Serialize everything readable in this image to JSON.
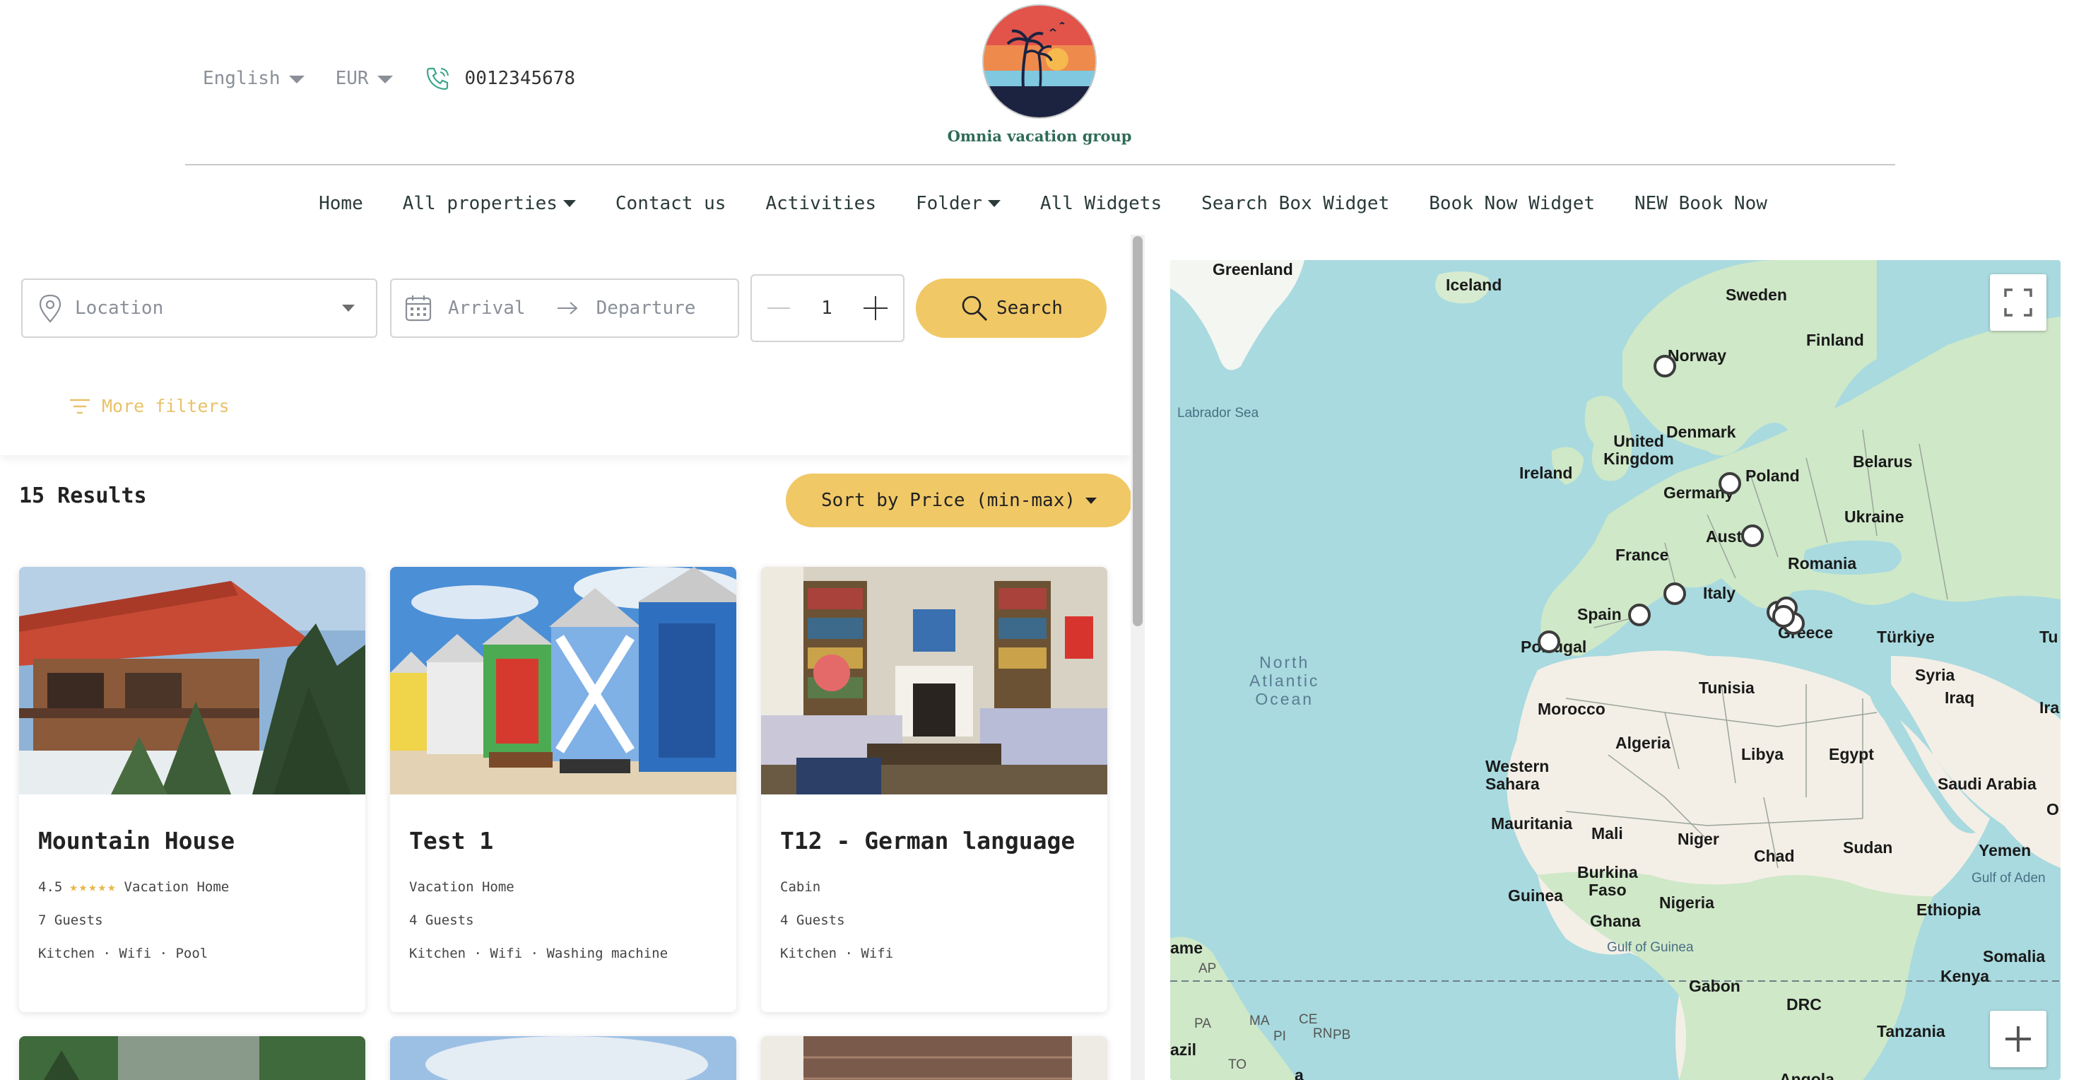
{
  "header": {
    "language": "English",
    "currency": "EUR",
    "phone": "0012345678",
    "logo_text": "Omnia vacation group"
  },
  "nav": {
    "items": [
      {
        "label": "Home"
      },
      {
        "label": "All properties",
        "has_dropdown": true
      },
      {
        "label": "Contact us"
      },
      {
        "label": "Activities"
      },
      {
        "label": "Folder",
        "has_dropdown": true
      },
      {
        "label": "All Widgets"
      },
      {
        "label": "Search Box Widget"
      },
      {
        "label": "Book Now Widget"
      },
      {
        "label": "NEW Book Now"
      }
    ]
  },
  "search": {
    "location_placeholder": "Location",
    "arrival_placeholder": "Arrival",
    "departure_placeholder": "Departure",
    "guests": "1",
    "button_label": "Search",
    "more_filters": "More filters"
  },
  "results": {
    "count_label": "15 Results",
    "sort_label": "Sort by Price (min-max)"
  },
  "properties": [
    {
      "title": "Mountain House",
      "rating": "4.5",
      "stars": "★★★★★",
      "type": "Vacation Home",
      "guests": "7 Guests",
      "amenities": "Kitchen · Wifi · Pool"
    },
    {
      "title": "Test 1",
      "type": "Vacation Home",
      "guests": "4 Guests",
      "amenities": "Kitchen · Wifi · Washing machine"
    },
    {
      "title": "T12 - German language",
      "type": "Cabin",
      "guests": "4 Guests",
      "amenities": "Kitchen · Wifi"
    }
  ],
  "map": {
    "labels": {
      "greenland": "Greenland",
      "iceland": "Iceland",
      "sweden": "Sweden",
      "finland": "Finland",
      "norway": "Norway",
      "labrador": "Labrador Sea",
      "denmark": "Denmark",
      "uk": "United Kingdom",
      "ireland": "Ireland",
      "poland": "Poland",
      "belarus": "Belarus",
      "germany": "Germany",
      "ukraine": "Ukraine",
      "austria": "Aust",
      "france": "France",
      "romania": "Romania",
      "italy": "Italy",
      "spain": "Spain",
      "portugal": "Portugal",
      "greece": "Greece",
      "turkiye": "Türkiye",
      "tu": "Tu",
      "ocean": "North\nAtlantic\nOcean",
      "tunisia": "Tunisia",
      "syria": "Syria",
      "iraq": "Iraq",
      "ira": "Ira",
      "morocco": "Morocco",
      "algeria": "Algeria",
      "libya": "Libya",
      "egypt": "Egypt",
      "western_sahara": "Western\nSahara",
      "saudi": "Saudi Arabia",
      "o": "O",
      "mauritania": "Mauritania",
      "mali": "Mali",
      "niger": "Niger",
      "chad": "Chad",
      "sudan": "Sudan",
      "yemen": "Yemen",
      "gulf_aden": "Gulf of Aden",
      "burkina": "Burkina\nFaso",
      "guinea": "Guinea",
      "nigeria": "Nigeria",
      "ethiopia": "Ethiopia",
      "ghana": "Ghana",
      "gulf_guinea": "Gulf of Guinea",
      "somalia": "Somalia",
      "ame": "ame",
      "ap": "AP",
      "gabon": "Gabon",
      "kenya": "Kenya",
      "drc": "DRC",
      "pa": "PA",
      "ma": "MA",
      "ce": "CE",
      "rn": "RN",
      "pi": "PI",
      "pb": "PB",
      "azil": "azil",
      "to": "TO",
      "tanzania": "Tanzania",
      "angola": "Angola",
      "a": "a"
    }
  },
  "colors": {
    "accent": "#f0c866",
    "water": "#a8dadf",
    "land": "#cfe8c8",
    "desert": "#f3efe6"
  }
}
